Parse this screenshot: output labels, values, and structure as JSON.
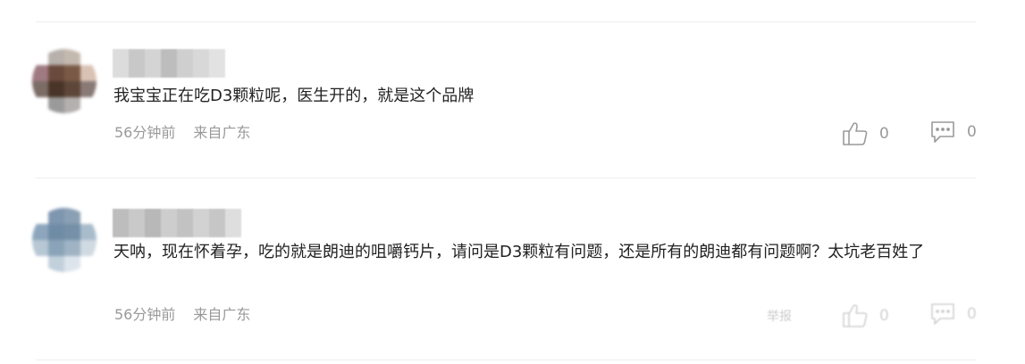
{
  "comments": [
    {
      "text": "我宝宝正在吃D3颗粒呢，医生开的，就是这个品牌",
      "time": "56分钟前",
      "location": "来自广东",
      "likes": "0",
      "replies": "0",
      "avatar_colors": [
        "#ffffff",
        "#b7b0ab",
        "#c4b9ae",
        "#ffffff",
        "#a07a82",
        "#6a4a3c",
        "#7a5a46",
        "#d9c2b4",
        "#7b6d66",
        "#4a3428",
        "#5e473a",
        "#8a7a76",
        "#ffffff",
        "#9a9a9a",
        "#b3b0ae",
        "#ffffff"
      ],
      "name_colors": [
        "#dcdcdc",
        "#c8c8c8",
        "#d4d4d4",
        "#bdbdbd",
        "#cfcfcf",
        "#d8d8d8",
        "#e2e2e2"
      ]
    },
    {
      "text": "天呐，现在怀着孕，吃的就是朗迪的咀嚼钙片，请问是D3颗粒有问题，还是所有的朗迪都有问题啊？太坑老百姓了",
      "time": "56分钟前",
      "location": "来自广东",
      "likes": "0",
      "replies": "0",
      "report": "举报",
      "avatar_colors": [
        "#ffffff",
        "#7f96b0",
        "#8aa0b4",
        "#ffffff",
        "#8da6bd",
        "#6f8ca5",
        "#7590a8",
        "#a9bccc",
        "#b7c7d4",
        "#8aa3b8",
        "#9fb3c4",
        "#d0dae2",
        "#ffffff",
        "#c2d0dc",
        "#dde5ec",
        "#ffffff"
      ],
      "name_colors": [
        "#bdbdbd",
        "#c9c9c9",
        "#b8b8b8",
        "#cdcdcd",
        "#c2c2c2",
        "#d2d2d2",
        "#c6c6c6",
        "#dedede"
      ]
    }
  ]
}
